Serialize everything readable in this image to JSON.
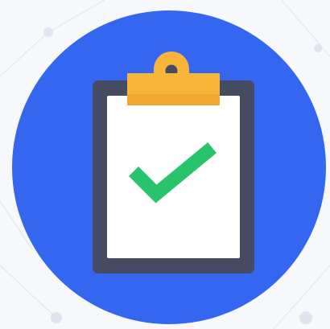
{
  "icon": {
    "name": "clipboard-check-icon",
    "colors": {
      "circle": "#3566f0",
      "board": "#454b63",
      "paper": "#ffffff",
      "clip": "#f9b43a",
      "clip_shade": "#e49b2a",
      "check": "#29c36b",
      "background_lines": "#e3e7f0"
    }
  }
}
